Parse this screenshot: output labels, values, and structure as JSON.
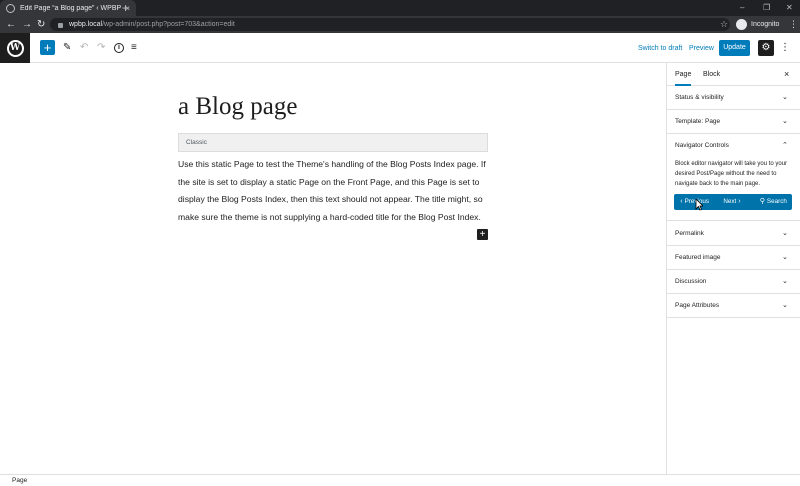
{
  "browser": {
    "tab_title": "Edit Page “a Blog page” ‹ WPBP",
    "tab_close": "×",
    "new_tab": "+",
    "url_host": "wpbp.local",
    "url_path": "/wp-admin/post.php?post=703&action=edit",
    "profile_label": "Incognito",
    "window_min": "–",
    "window_max": "❐",
    "window_close": "✕"
  },
  "editor_header": {
    "add_block_label": "+",
    "switch_to_draft": "Switch to draft",
    "preview": "Preview",
    "update": "Update"
  },
  "content": {
    "title": "a Blog page",
    "classic_label": "Classic",
    "body": "Use this static Page to test the Theme's handling of the Blog Posts Index page. If the site is set to display a static Page on the Front Page, and this Page is set to display the Blog Posts Index, then this text should not appear. The title might, so make sure the theme is not supplying a hard-coded title for the Blog Post Index.",
    "inline_add": "+"
  },
  "sidebar": {
    "tabs": [
      {
        "label": "Page",
        "active": true
      },
      {
        "label": "Block",
        "active": false
      }
    ],
    "close": "×",
    "panels_top": [
      {
        "title": "Status & visibility"
      },
      {
        "title": "Template: Page"
      }
    ],
    "navigator": {
      "title": "Navigator Controls",
      "description": "Block editor navigator will take you to your desired Post/Page without the need to navigate back to the main page.",
      "buttons": {
        "previous": "Previous",
        "next": "Next",
        "search": "Search"
      }
    },
    "panels_bottom": [
      {
        "title": "Permalink"
      },
      {
        "title": "Featured image"
      },
      {
        "title": "Discussion"
      },
      {
        "title": "Page Attributes"
      }
    ]
  },
  "footer": {
    "breadcrumb": "Page"
  },
  "colors": {
    "accent": "#007cba",
    "nav_button_bg": "#0073aa",
    "chrome_dark": "#202124"
  }
}
